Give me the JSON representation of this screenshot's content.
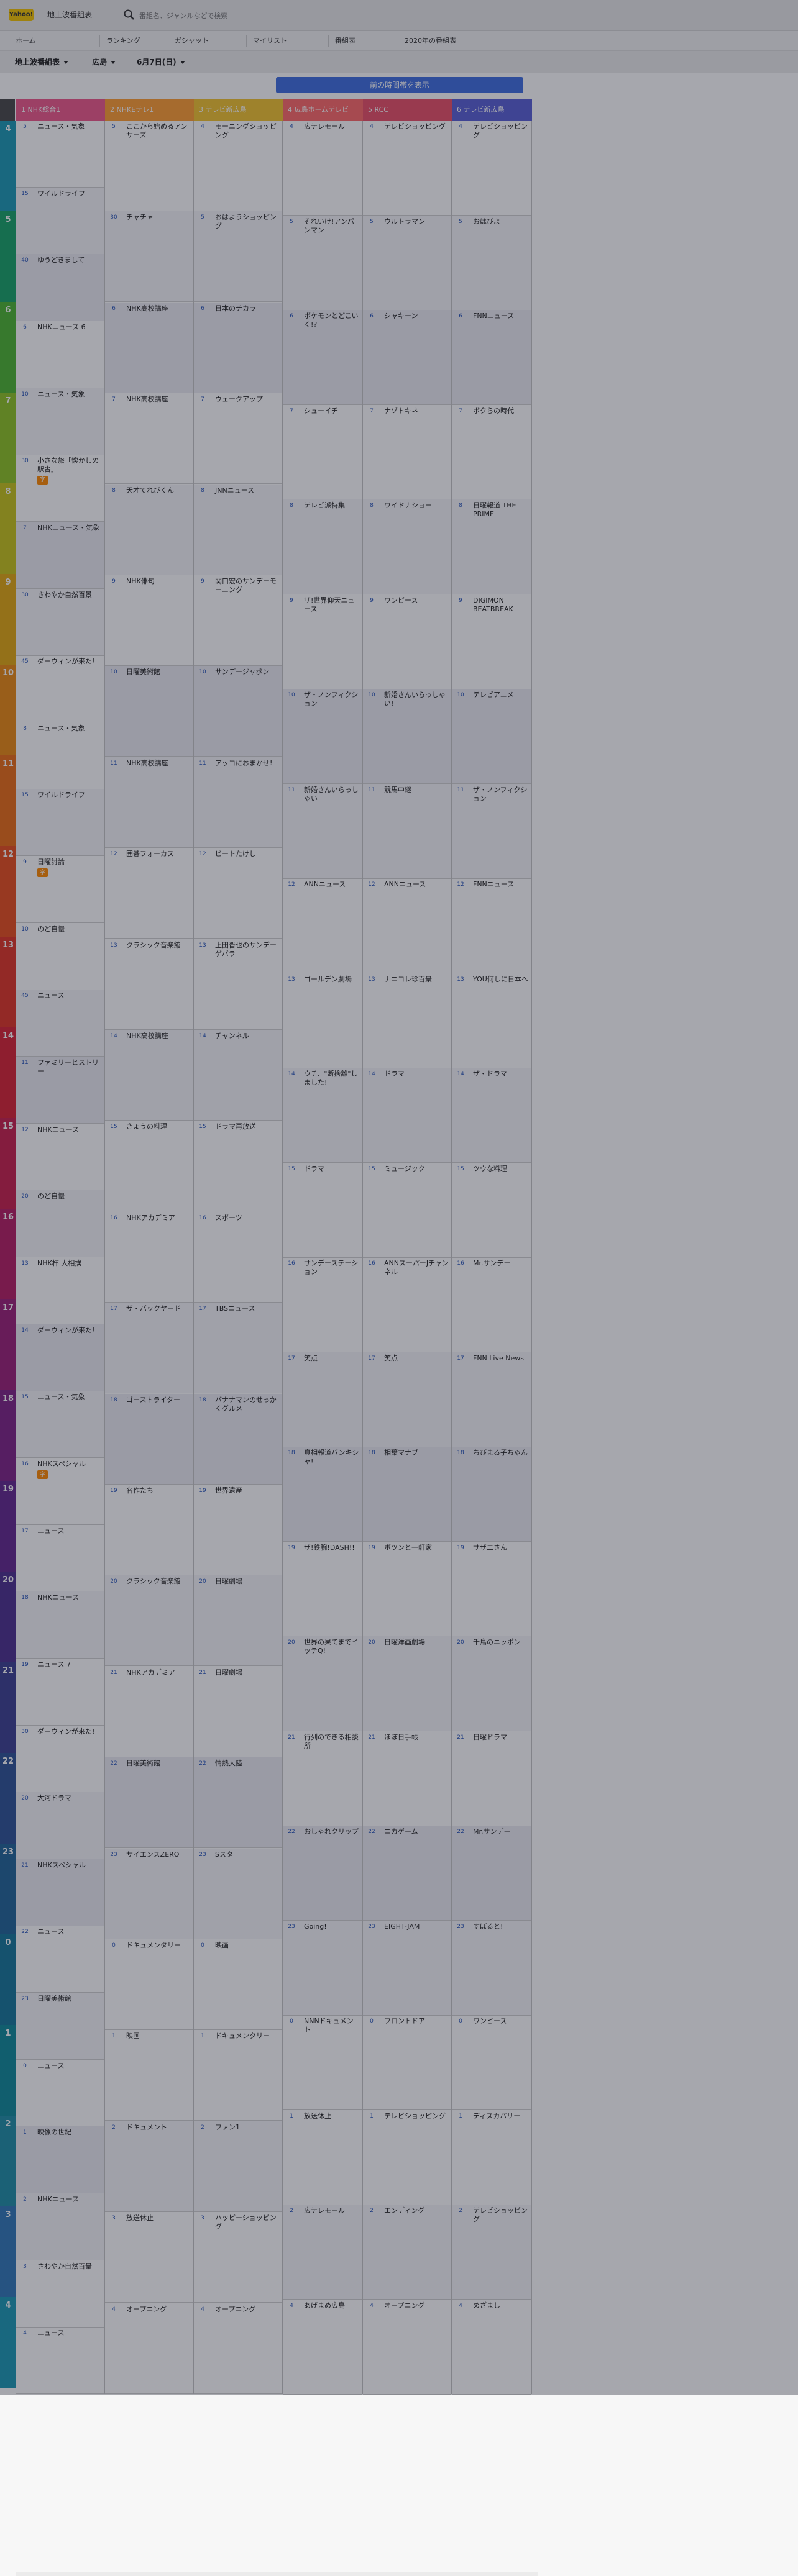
{
  "header": {
    "logo": "Yahoo!",
    "app_name": "地上波番組表",
    "search_placeholder": "番組名、ジャンルなどで検索"
  },
  "subnav": [
    "ホーム",
    "ランキング",
    "ガシャット",
    "マイリスト",
    "番組表",
    "2020年の番組表"
  ],
  "filters": {
    "region": "地上波番組表",
    "area": "広島",
    "date": "6月7日(日)"
  },
  "prev_button": "前の時間帯を表示",
  "channels": [
    {
      "name": "1 NHK総合1",
      "color": "#ef5a8c"
    },
    {
      "name": "2 NHKEテレ1",
      "color": "#ff9e33"
    },
    {
      "name": "3 テレビ新広島",
      "color": "#f2c430"
    },
    {
      "name": "4 広島ホームテレビ",
      "color": "#ff6a6a"
    },
    {
      "name": "5 RCC",
      "color": "#ea4f68"
    },
    {
      "name": "6 テレビ新広島",
      "color": "#5a5fd6"
    }
  ],
  "hours": [
    "4",
    "5",
    "6",
    "7",
    "8",
    "9",
    "10",
    "11",
    "12",
    "13",
    "14",
    "15",
    "16",
    "17",
    "18",
    "19",
    "20",
    "21",
    "22",
    "23",
    "0",
    "1",
    "2",
    "3",
    "4"
  ],
  "hour_colors": [
    "#1c9ab5",
    "#17a368",
    "#4cb531",
    "#8fc424",
    "#c7c31a",
    "#e2a911",
    "#ea8912",
    "#ea6c16",
    "#e84e1d",
    "#e03426",
    "#d92235",
    "#c9204c",
    "#b51e63",
    "#9b1f78",
    "#7e2387",
    "#63288e",
    "#4c2f8f",
    "#3d3f92",
    "#2e5396",
    "#216598",
    "#167799",
    "#0f8a9a",
    "#1f8fa7",
    "#3178b8",
    "#1c9ab5"
  ],
  "columns": [
    {
      "programs": [
        {
          "time": "5",
          "title": "ニュース・気象",
          "badge": ""
        },
        {
          "time": "15",
          "title": "ワイルドライフ",
          "badge": ""
        },
        {
          "time": "40",
          "title": "ゆうどきまして",
          "badge": ""
        },
        {
          "time": "6",
          "title": "NHKニュース 6",
          "badge": ""
        },
        {
          "time": "10",
          "title": "ニュース・気象",
          "badge": ""
        },
        {
          "time": "30",
          "title": "小さな旅「懐かしの駅舎」",
          "badge": "字"
        },
        {
          "time": "7",
          "title": "NHKニュース・気象",
          "badge": ""
        },
        {
          "time": "30",
          "title": "さわやか自然百景",
          "badge": ""
        },
        {
          "time": "45",
          "title": "ダーウィンが来た!",
          "badge": ""
        },
        {
          "time": "8",
          "title": "ニュース・気象",
          "badge": ""
        },
        {
          "time": "15",
          "title": "ワイルドライフ",
          "badge": ""
        },
        {
          "time": "9",
          "title": "日曜討論",
          "badge": "字"
        },
        {
          "time": "10",
          "title": "のど自慢",
          "badge": ""
        },
        {
          "time": "45",
          "title": "ニュース",
          "badge": ""
        },
        {
          "time": "11",
          "title": "ファミリーヒストリー",
          "badge": ""
        },
        {
          "time": "12",
          "title": "NHKニュース",
          "badge": ""
        },
        {
          "time": "20",
          "title": "のど自慢",
          "badge": ""
        },
        {
          "time": "13",
          "title": "NHK杯 大相撲",
          "badge": ""
        },
        {
          "time": "14",
          "title": "ダーウィンが来た!",
          "badge": ""
        },
        {
          "time": "15",
          "title": "ニュース・気象",
          "badge": ""
        },
        {
          "time": "16",
          "title": "NHKスペシャル",
          "badge": "字"
        },
        {
          "time": "17",
          "title": "ニュース",
          "badge": ""
        },
        {
          "time": "18",
          "title": "NHKニュース",
          "badge": ""
        },
        {
          "time": "19",
          "title": "ニュース 7",
          "badge": ""
        },
        {
          "time": "30",
          "title": "ダーウィンが来た!",
          "badge": ""
        },
        {
          "time": "20",
          "title": "大河ドラマ",
          "badge": ""
        },
        {
          "time": "21",
          "title": "NHKスペシャル",
          "badge": ""
        },
        {
          "time": "22",
          "title": "ニュース",
          "badge": ""
        },
        {
          "time": "23",
          "title": "日曜美術館",
          "badge": ""
        },
        {
          "time": "0",
          "title": "ニュース",
          "badge": ""
        },
        {
          "time": "1",
          "title": "映像の世紀",
          "badge": ""
        },
        {
          "time": "2",
          "title": "NHKニュース",
          "badge": ""
        },
        {
          "time": "3",
          "title": "さわやか自然百景",
          "badge": ""
        },
        {
          "time": "4",
          "title": "ニュース",
          "badge": ""
        }
      ]
    },
    {
      "programs": [
        {
          "time": "5",
          "title": "ここから始めるアンサーズ",
          "badge": ""
        },
        {
          "time": "30",
          "title": "チャチャ",
          "badge": ""
        },
        {
          "time": "6",
          "title": "NHK高校講座",
          "badge": ""
        },
        {
          "time": "7",
          "title": "NHK高校講座",
          "badge": ""
        },
        {
          "time": "8",
          "title": "天才てれびくん",
          "badge": ""
        },
        {
          "time": "9",
          "title": "NHK俳句",
          "badge": ""
        },
        {
          "time": "10",
          "title": "日曜美術館",
          "badge": ""
        },
        {
          "time": "11",
          "title": "NHK高校講座",
          "badge": ""
        },
        {
          "time": "12",
          "title": "囲碁フォーカス",
          "badge": ""
        },
        {
          "time": "13",
          "title": "クラシック音楽館",
          "badge": ""
        },
        {
          "time": "14",
          "title": "NHK高校講座",
          "badge": ""
        },
        {
          "time": "15",
          "title": "きょうの料理",
          "badge": ""
        },
        {
          "time": "16",
          "title": "NHKアカデミア",
          "badge": ""
        },
        {
          "time": "17",
          "title": "ザ・バックヤード",
          "badge": ""
        },
        {
          "time": "18",
          "title": "ゴーストライター",
          "badge": ""
        },
        {
          "time": "19",
          "title": "名作たち",
          "badge": ""
        },
        {
          "time": "20",
          "title": "クラシック音楽館",
          "badge": ""
        },
        {
          "time": "21",
          "title": "NHKアカデミア",
          "badge": ""
        },
        {
          "time": "22",
          "title": "日曜美術館",
          "badge": ""
        },
        {
          "time": "23",
          "title": "サイエンスZERO",
          "badge": ""
        },
        {
          "time": "0",
          "title": "ドキュメンタリー",
          "badge": ""
        },
        {
          "time": "1",
          "title": "映画",
          "badge": ""
        },
        {
          "time": "2",
          "title": "ドキュメント",
          "badge": ""
        },
        {
          "time": "3",
          "title": "放送休止",
          "badge": ""
        },
        {
          "time": "4",
          "title": "オープニング",
          "badge": ""
        }
      ]
    },
    {
      "programs": [
        {
          "time": "4",
          "title": "モーニングショッピング",
          "badge": ""
        },
        {
          "time": "5",
          "title": "おはようショッピング",
          "badge": ""
        },
        {
          "time": "6",
          "title": "日本のチカラ",
          "badge": ""
        },
        {
          "time": "7",
          "title": "ウェークアップ",
          "badge": ""
        },
        {
          "time": "8",
          "title": "JNNニュース",
          "badge": ""
        },
        {
          "time": "9",
          "title": "関口宏のサンデーモーニング",
          "badge": ""
        },
        {
          "time": "10",
          "title": "サンデージャポン",
          "badge": ""
        },
        {
          "time": "11",
          "title": "アッコにおまかせ!",
          "badge": ""
        },
        {
          "time": "12",
          "title": "ビートたけし",
          "badge": ""
        },
        {
          "time": "13",
          "title": "上田晋也のサンデーゲバラ",
          "badge": ""
        },
        {
          "time": "14",
          "title": "チャンネル",
          "badge": ""
        },
        {
          "time": "15",
          "title": "ドラマ再放送",
          "badge": ""
        },
        {
          "time": "16",
          "title": "スポーツ",
          "badge": ""
        },
        {
          "time": "17",
          "title": "TBSニュース",
          "badge": ""
        },
        {
          "time": "18",
          "title": "バナナマンのせっかくグルメ",
          "badge": ""
        },
        {
          "time": "19",
          "title": "世界遺産",
          "badge": ""
        },
        {
          "time": "20",
          "title": "日曜劇場",
          "badge": ""
        },
        {
          "time": "21",
          "title": "日曜劇場",
          "badge": ""
        },
        {
          "time": "22",
          "title": "情熱大陸",
          "badge": ""
        },
        {
          "time": "23",
          "title": "Sスタ",
          "badge": ""
        },
        {
          "time": "0",
          "title": "映画",
          "badge": ""
        },
        {
          "time": "1",
          "title": "ドキュメンタリー",
          "badge": ""
        },
        {
          "time": "2",
          "title": "ファン1",
          "badge": ""
        },
        {
          "time": "3",
          "title": "ハッピーショッピング",
          "badge": ""
        },
        {
          "time": "4",
          "title": "オープニング",
          "badge": ""
        }
      ]
    },
    {
      "programs": [
        {
          "time": "4",
          "title": "広テレモール",
          "badge": ""
        },
        {
          "time": "5",
          "title": "それいけ!アンパンマン",
          "badge": ""
        },
        {
          "time": "6",
          "title": "ポケモンとどこいく!?",
          "badge": ""
        },
        {
          "time": "7",
          "title": "シューイチ",
          "badge": ""
        },
        {
          "time": "8",
          "title": "テレビ派特集",
          "badge": ""
        },
        {
          "time": "9",
          "title": "ザ!世界仰天ニュース",
          "badge": ""
        },
        {
          "time": "10",
          "title": "ザ・ノンフィクション",
          "badge": ""
        },
        {
          "time": "11",
          "title": "新婚さんいらっしゃい",
          "badge": ""
        },
        {
          "time": "12",
          "title": "ANNニュース",
          "badge": ""
        },
        {
          "time": "13",
          "title": "ゴールデン劇場",
          "badge": ""
        },
        {
          "time": "14",
          "title": "ウチ、\"断捨離\"しました!",
          "badge": ""
        },
        {
          "time": "15",
          "title": "ドラマ",
          "badge": ""
        },
        {
          "time": "16",
          "title": "サンデーステーション",
          "badge": ""
        },
        {
          "time": "17",
          "title": "笑点",
          "badge": ""
        },
        {
          "time": "18",
          "title": "真相報道バンキシャ!",
          "badge": ""
        },
        {
          "time": "19",
          "title": "ザ!鉄腕!DASH!!",
          "badge": ""
        },
        {
          "time": "20",
          "title": "世界の果てまでイッテQ!",
          "badge": ""
        },
        {
          "time": "21",
          "title": "行列のできる相談所",
          "badge": ""
        },
        {
          "time": "22",
          "title": "おしゃれクリップ",
          "badge": ""
        },
        {
          "time": "23",
          "title": "Going!",
          "badge": ""
        },
        {
          "time": "0",
          "title": "NNNドキュメント",
          "badge": ""
        },
        {
          "time": "1",
          "title": "放送休止",
          "badge": ""
        },
        {
          "time": "2",
          "title": "広テレモール",
          "badge": ""
        },
        {
          "time": "4",
          "title": "あげまめ広島",
          "badge": ""
        }
      ]
    },
    {
      "programs": [
        {
          "time": "4",
          "title": "テレビショッピング",
          "badge": ""
        },
        {
          "time": "5",
          "title": "ウルトラマン",
          "badge": ""
        },
        {
          "time": "6",
          "title": "シャキーン",
          "badge": ""
        },
        {
          "time": "7",
          "title": "ナゾトキネ",
          "badge": ""
        },
        {
          "time": "8",
          "title": "ワイドナショー",
          "badge": ""
        },
        {
          "time": "9",
          "title": "ワンピース",
          "badge": ""
        },
        {
          "time": "10",
          "title": "新婚さんいらっしゃい!",
          "badge": ""
        },
        {
          "time": "11",
          "title": "競馬中継",
          "badge": ""
        },
        {
          "time": "12",
          "title": "ANNニュース",
          "badge": ""
        },
        {
          "time": "13",
          "title": "ナニコレ珍百景",
          "badge": ""
        },
        {
          "time": "14",
          "title": "ドラマ",
          "badge": ""
        },
        {
          "time": "15",
          "title": "ミュージック",
          "badge": ""
        },
        {
          "time": "16",
          "title": "ANNスーパーJチャンネル",
          "badge": ""
        },
        {
          "time": "17",
          "title": "笑点",
          "badge": ""
        },
        {
          "time": "18",
          "title": "相葉マナブ",
          "badge": ""
        },
        {
          "time": "19",
          "title": "ポツンと一軒家",
          "badge": ""
        },
        {
          "time": "20",
          "title": "日曜洋画劇場",
          "badge": ""
        },
        {
          "time": "21",
          "title": "ほぼ日手帳",
          "badge": ""
        },
        {
          "time": "22",
          "title": "ニカゲーム",
          "badge": ""
        },
        {
          "time": "23",
          "title": "EIGHT-JAM",
          "badge": ""
        },
        {
          "time": "0",
          "title": "フロントドア",
          "badge": ""
        },
        {
          "time": "1",
          "title": "テレビショッピング",
          "badge": ""
        },
        {
          "time": "2",
          "title": "エンディング",
          "badge": ""
        },
        {
          "time": "4",
          "title": "オープニング",
          "badge": ""
        }
      ]
    },
    {
      "programs": [
        {
          "time": "4",
          "title": "テレビショッピング",
          "badge": ""
        },
        {
          "time": "5",
          "title": "おはびよ",
          "badge": ""
        },
        {
          "time": "6",
          "title": "FNNニュース",
          "badge": ""
        },
        {
          "time": "7",
          "title": "ボクらの時代",
          "badge": ""
        },
        {
          "time": "8",
          "title": "日曜報道 THE PRIME",
          "badge": ""
        },
        {
          "time": "9",
          "title": "DIGIMON BEATBREAK",
          "badge": ""
        },
        {
          "time": "10",
          "title": "テレビアニメ",
          "badge": ""
        },
        {
          "time": "11",
          "title": "ザ・ノンフィクション",
          "badge": ""
        },
        {
          "time": "12",
          "title": "FNNニュース",
          "badge": ""
        },
        {
          "time": "13",
          "title": "YOU何しに日本へ",
          "badge": ""
        },
        {
          "time": "14",
          "title": "ザ・ドラマ",
          "badge": ""
        },
        {
          "time": "15",
          "title": "ツウな料理",
          "badge": ""
        },
        {
          "time": "16",
          "title": "Mr.サンデー",
          "badge": ""
        },
        {
          "time": "17",
          "title": "FNN Live News",
          "badge": ""
        },
        {
          "time": "18",
          "title": "ちびまる子ちゃん",
          "badge": ""
        },
        {
          "time": "19",
          "title": "サザエさん",
          "badge": ""
        },
        {
          "time": "20",
          "title": "千鳥のニッポン",
          "badge": ""
        },
        {
          "time": "21",
          "title": "日曜ドラマ",
          "badge": ""
        },
        {
          "time": "22",
          "title": "Mr.サンデー",
          "badge": ""
        },
        {
          "time": "23",
          "title": "すぽると!",
          "badge": ""
        },
        {
          "time": "0",
          "title": "ワンピース",
          "badge": ""
        },
        {
          "time": "1",
          "title": "ディスカバリー",
          "badge": ""
        },
        {
          "time": "2",
          "title": "テレビショッピング",
          "badge": ""
        },
        {
          "time": "4",
          "title": "めざまし",
          "badge": ""
        }
      ]
    }
  ]
}
